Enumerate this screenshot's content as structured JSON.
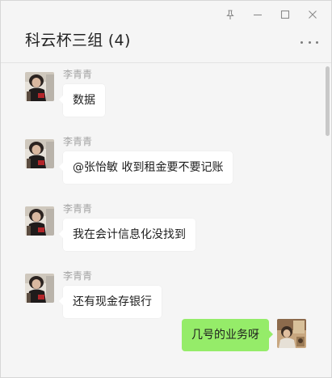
{
  "window": {
    "title": "科云杯三组 (4)",
    "controls": {
      "pin_icon": "pin-icon",
      "minimize_icon": "minimize-icon",
      "maximize_icon": "maximize-icon",
      "close_icon": "close-icon"
    },
    "more_icon": "more-dots-icon"
  },
  "messages": [
    {
      "sender": "李青青",
      "text": "数据"
    },
    {
      "sender": "李青青",
      "text": "@张怡敏 收到租金要不要记账"
    },
    {
      "sender": "李青青",
      "text": "我在会计信息化没找到"
    },
    {
      "sender": "李青青",
      "text": "还有现金存银行"
    }
  ],
  "self_message": {
    "text": "几号的业务呀"
  },
  "colors": {
    "background": "#f5f5f5",
    "bubble_other": "#ffffff",
    "bubble_self": "#95ec69",
    "sender_name": "#a3a3a3"
  }
}
